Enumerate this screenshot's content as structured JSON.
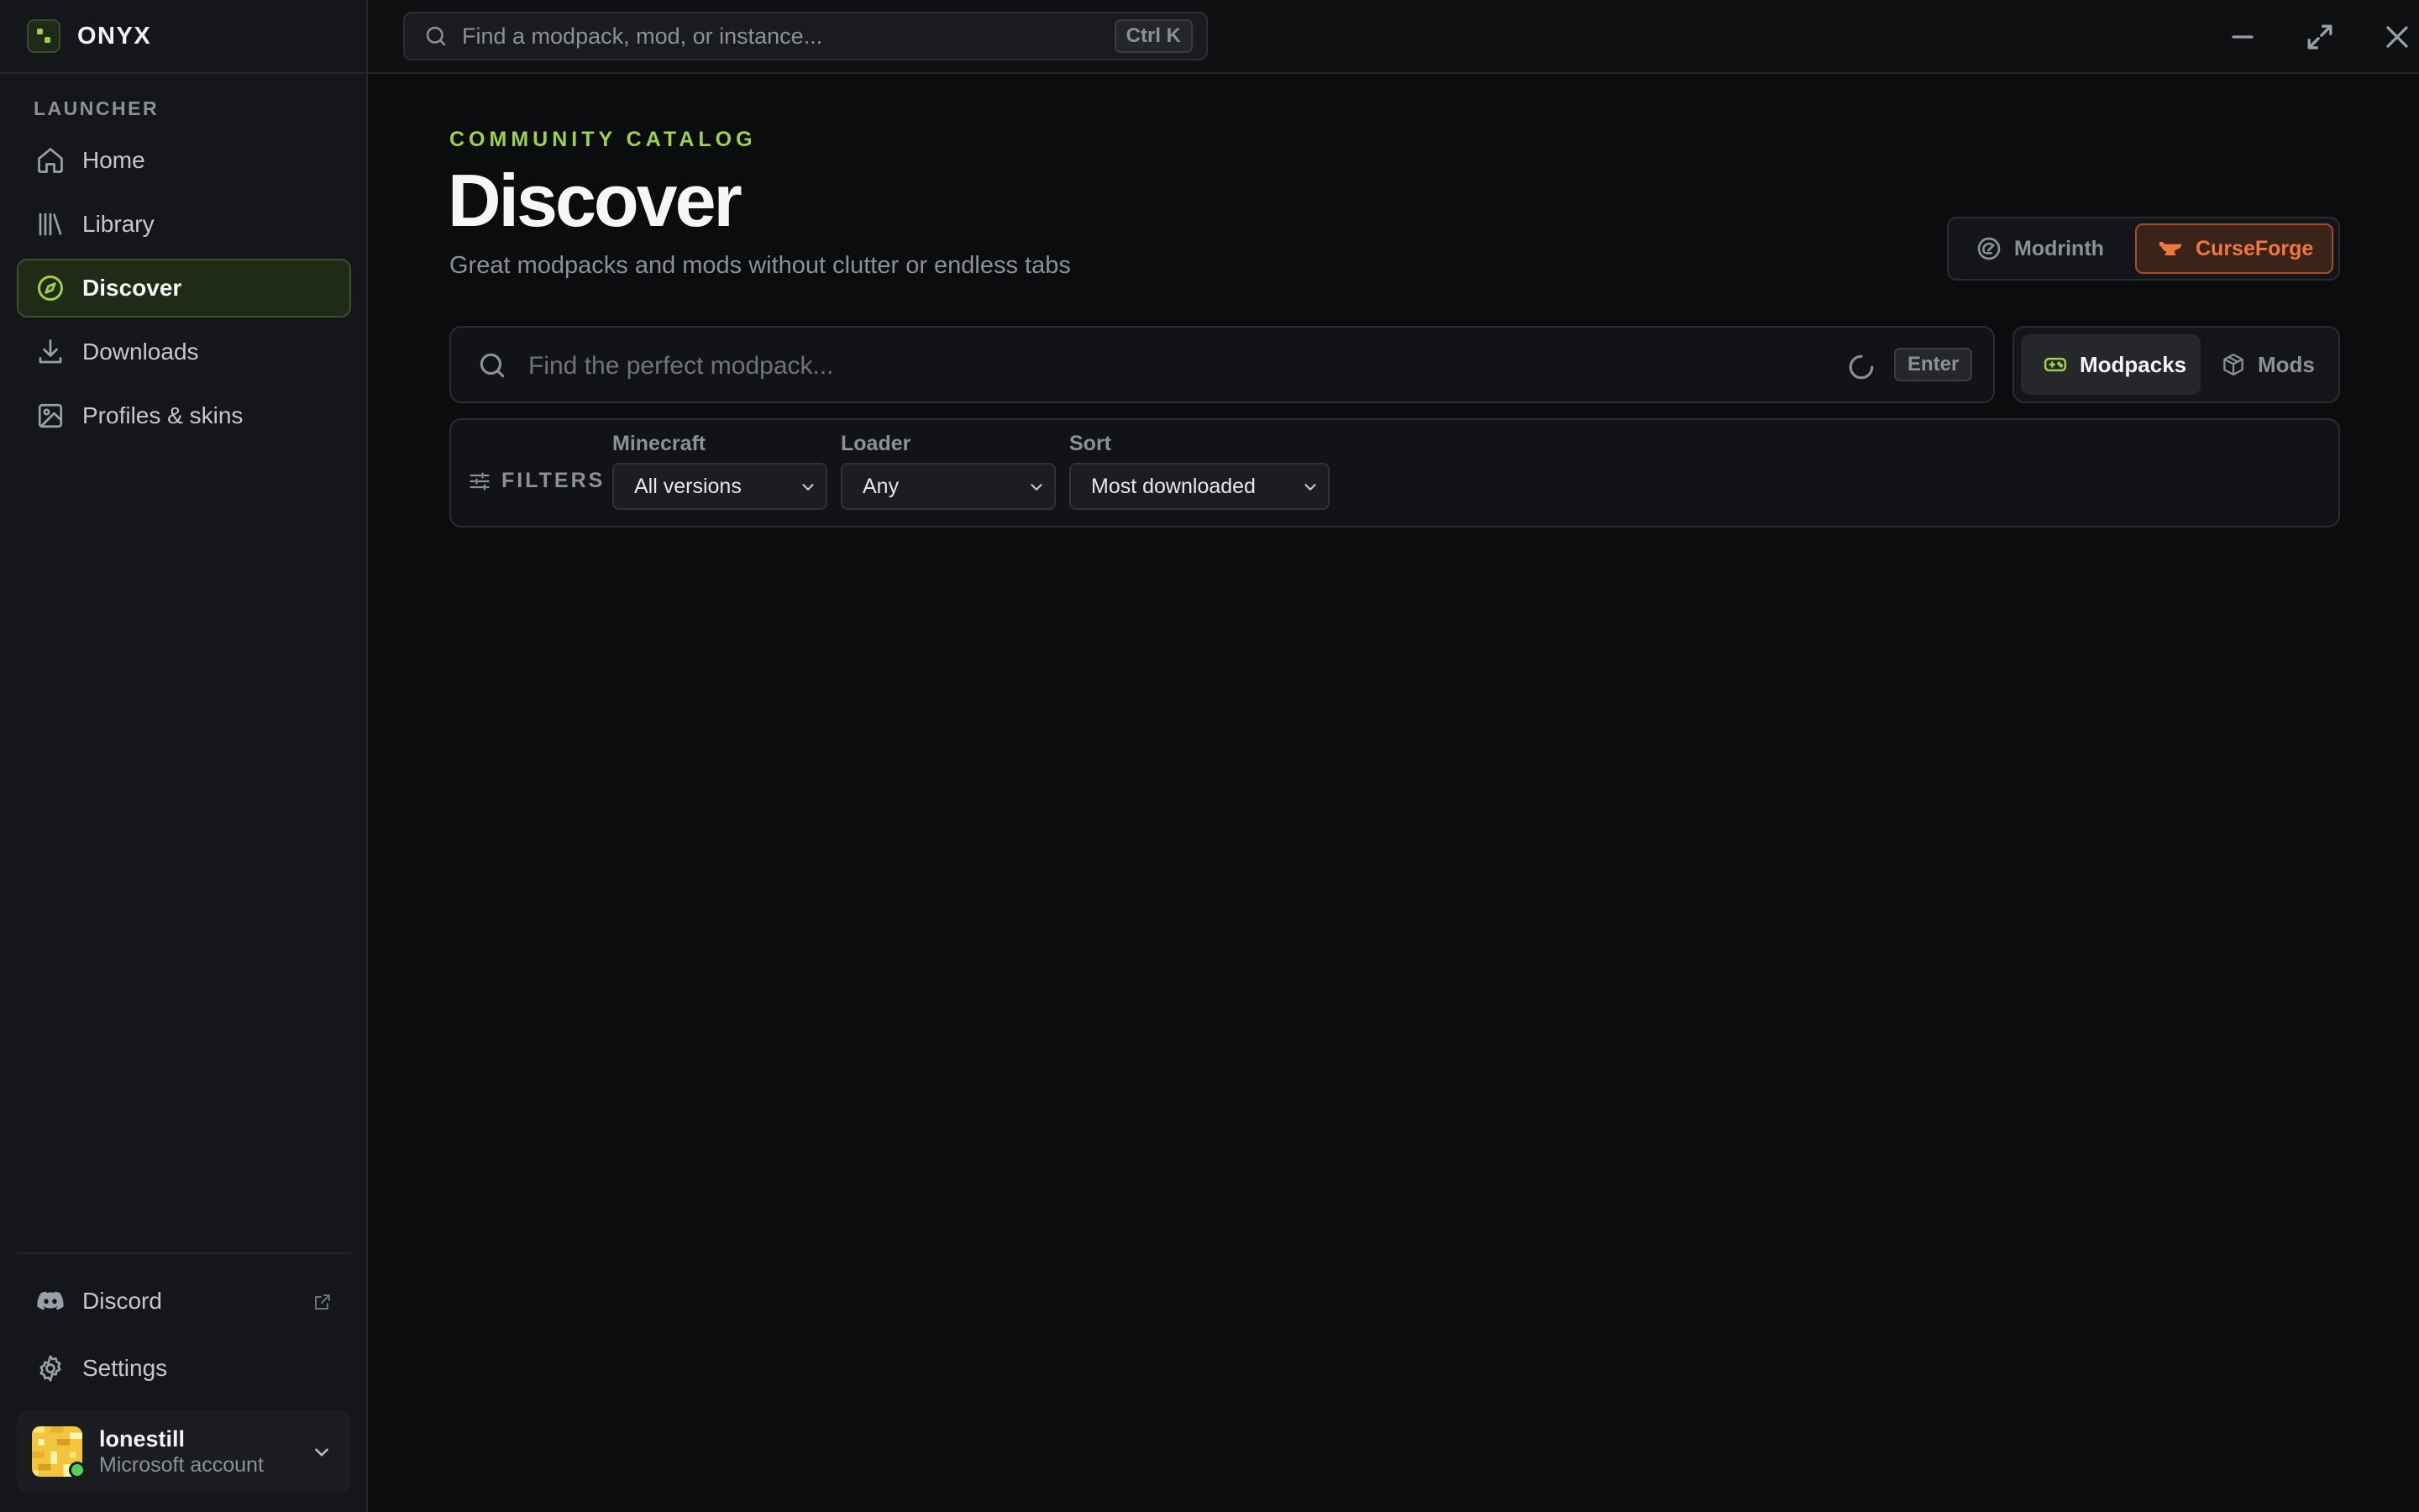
{
  "app": {
    "name": "ONYX"
  },
  "sidebar": {
    "section_label": "LAUNCHER",
    "items": [
      {
        "label": "Home",
        "icon": "home-icon"
      },
      {
        "label": "Library",
        "icon": "library-icon"
      },
      {
        "label": "Discover",
        "icon": "compass-icon",
        "active": true
      },
      {
        "label": "Downloads",
        "icon": "download-icon"
      },
      {
        "label": "Profiles & skins",
        "icon": "image-icon"
      }
    ],
    "discord_label": "Discord",
    "settings_label": "Settings",
    "account": {
      "name": "lonestill",
      "type": "Microsoft account"
    }
  },
  "topbar": {
    "search_placeholder": "Find a modpack, mod, or instance...",
    "shortcut": "Ctrl K"
  },
  "page": {
    "eyebrow": "COMMUNITY CATALOG",
    "title": "Discover",
    "subtitle": "Great modpacks and mods without clutter or endless tabs"
  },
  "providers": {
    "modrinth": "Modrinth",
    "curseforge": "CurseForge",
    "selected": "CurseForge"
  },
  "search": {
    "placeholder": "Find the perfect modpack...",
    "enter_hint": "Enter"
  },
  "content_types": {
    "modpacks": "Modpacks",
    "mods": "Mods",
    "selected": "Modpacks"
  },
  "filters": {
    "label": "FILTERS",
    "minecraft": {
      "label": "Minecraft",
      "value": "All versions"
    },
    "loader": {
      "label": "Loader",
      "value": "Any"
    },
    "sort": {
      "label": "Sort",
      "value": "Most downloaded"
    }
  },
  "colors": {
    "accent": "#9ed14a",
    "curseforge": "#f0773e",
    "background": "#0b0c0e"
  }
}
